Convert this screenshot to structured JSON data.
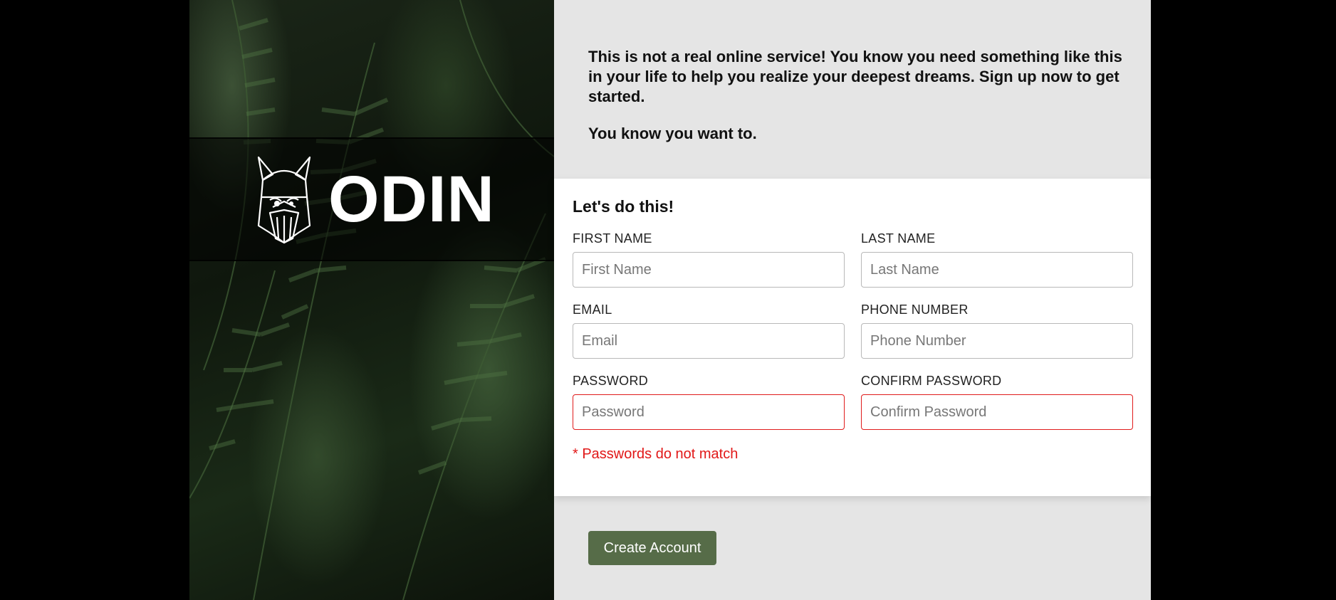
{
  "brand": {
    "name": "ODIN",
    "icon": "viking-helmet-icon"
  },
  "intro": {
    "paragraph1": "This is not a real online service! You know you need something like this in your life to help you realize your deepest dreams. Sign up now to get started.",
    "paragraph2": "You know you want to."
  },
  "form": {
    "title": "Let's do this!",
    "first_name": {
      "label": "FIRST NAME",
      "placeholder": "First Name",
      "value": ""
    },
    "last_name": {
      "label": "LAST NAME",
      "placeholder": "Last Name",
      "value": ""
    },
    "email": {
      "label": "EMAIL",
      "placeholder": "Email",
      "value": ""
    },
    "phone": {
      "label": "PHONE NUMBER",
      "placeholder": "Phone Number",
      "value": ""
    },
    "password": {
      "label": "PASSWORD",
      "placeholder": "Password",
      "value": ""
    },
    "confirm_password": {
      "label": "CONFIRM PASSWORD",
      "placeholder": "Confirm Password",
      "value": ""
    },
    "error": "* Passwords do not match"
  },
  "submit": {
    "label": "Create Account"
  },
  "colors": {
    "accent": "#566c48",
    "error": "#e11818",
    "panel_bg": "#e5e5e5",
    "card_bg": "#ffffff"
  }
}
